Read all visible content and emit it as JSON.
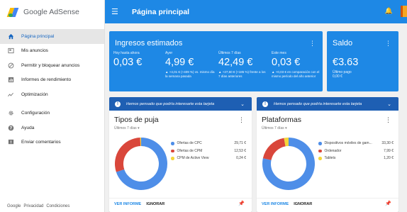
{
  "app": {
    "name": "Google AdSense"
  },
  "topbar": {
    "title": "Página principal"
  },
  "sidebar": {
    "items": [
      {
        "label": "Página principal",
        "icon": "home-icon",
        "active": true
      },
      {
        "label": "Mis anuncios",
        "icon": "ad-box-icon"
      },
      {
        "label": "Permitir y bloquear anuncios",
        "icon": "block-icon"
      },
      {
        "label": "Informes de rendimiento",
        "icon": "bar-chart-icon"
      },
      {
        "label": "Optimización",
        "icon": "trend-icon"
      },
      {
        "label": "Configuración",
        "icon": "gear-icon"
      },
      {
        "label": "Ayuda",
        "icon": "help-icon"
      },
      {
        "label": "Enviar comentarios",
        "icon": "feedback-icon"
      }
    ],
    "footer": [
      "Google",
      "Privacidad",
      "Condiciones"
    ]
  },
  "earnings": {
    "title": "Ingresos estimados",
    "stats": [
      {
        "label": "Hoy hasta ahora",
        "value": "0,03 €",
        "compare": ""
      },
      {
        "label": "Ayer",
        "value": "4,99 €",
        "compare": "▲ +4,01 € (+409 %) vs. mismo día la semana pasada"
      },
      {
        "label": "Últimos 7 días",
        "value": "42,49 €",
        "compare": "▲ +27,60 € (+185 %) frente a los 7 días anteriores"
      },
      {
        "label": "Este mes",
        "value": "0,03 €",
        "compare": "▲ +0,03 € en comparación con el mismo período del año anterior"
      }
    ]
  },
  "balance": {
    "title": "Saldo",
    "value": "€3.63",
    "label": "Último pago",
    "last_payment": "0,00 €"
  },
  "tip_text": "Hemos pensado que podría interesarte esta tarjeta",
  "cards": [
    {
      "title": "Tipos de puja",
      "range": "Últimos 7 días",
      "action_primary": "VER INFORME",
      "action_secondary": "IGNORAR",
      "legend": [
        {
          "name": "Ofertas de CPC",
          "value": "29,71 €",
          "color": "#4e8ee8"
        },
        {
          "name": "Ofertas de CPM",
          "value": "12,53 €",
          "color": "#d9473b"
        },
        {
          "name": "CPM de Active View",
          "value": "0,24 €",
          "color": "#f4d63a"
        }
      ]
    },
    {
      "title": "Plataformas",
      "range": "Últimos 7 días",
      "action_primary": "VER INFORME",
      "action_secondary": "IGNORAR",
      "legend": [
        {
          "name": "Dispositivos móviles de gam...",
          "value": "33,30 €",
          "color": "#4e8ee8"
        },
        {
          "name": "Ordenador",
          "value": "7,99 €",
          "color": "#d9473b"
        },
        {
          "name": "Tablets",
          "value": "1,20 €",
          "color": "#f4d63a"
        }
      ]
    }
  ],
  "chart_data": [
    {
      "type": "pie",
      "categories": [
        "Ofertas de CPC",
        "Ofertas de CPM",
        "CPM de Active View"
      ],
      "values": [
        29.71,
        12.53,
        0.24
      ]
    },
    {
      "type": "pie",
      "categories": [
        "Dispositivos móviles de gam...",
        "Ordenador",
        "Tablets"
      ],
      "values": [
        33.3,
        7.99,
        1.2
      ]
    }
  ]
}
